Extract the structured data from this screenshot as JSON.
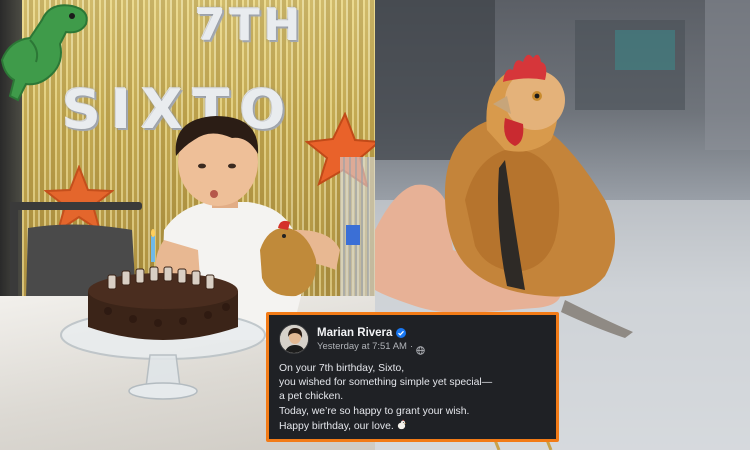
{
  "left_photo": {
    "balloon_top": "7TH",
    "balloon_name": "SIXTO"
  },
  "post": {
    "author_name": "Marian Rivera",
    "verified_icon": "verified-badge-icon",
    "timestamp": "Yesterday at 7:51 AM",
    "separator": "·",
    "audience_icon": "globe-icon",
    "lines": [
      "On your 7th birthday, Sixto,",
      "you wished for something simple yet special—",
      "a pet chicken.",
      "Today, we’re so happy to grant your wish.",
      "Happy birthday, our love."
    ],
    "trailing_emoji": "chicken-icon"
  },
  "colors": {
    "card_background": "#1f2125",
    "card_border": "#f27b17",
    "verified_blue": "#1877f2",
    "foil_gold": "#c7ad55"
  }
}
